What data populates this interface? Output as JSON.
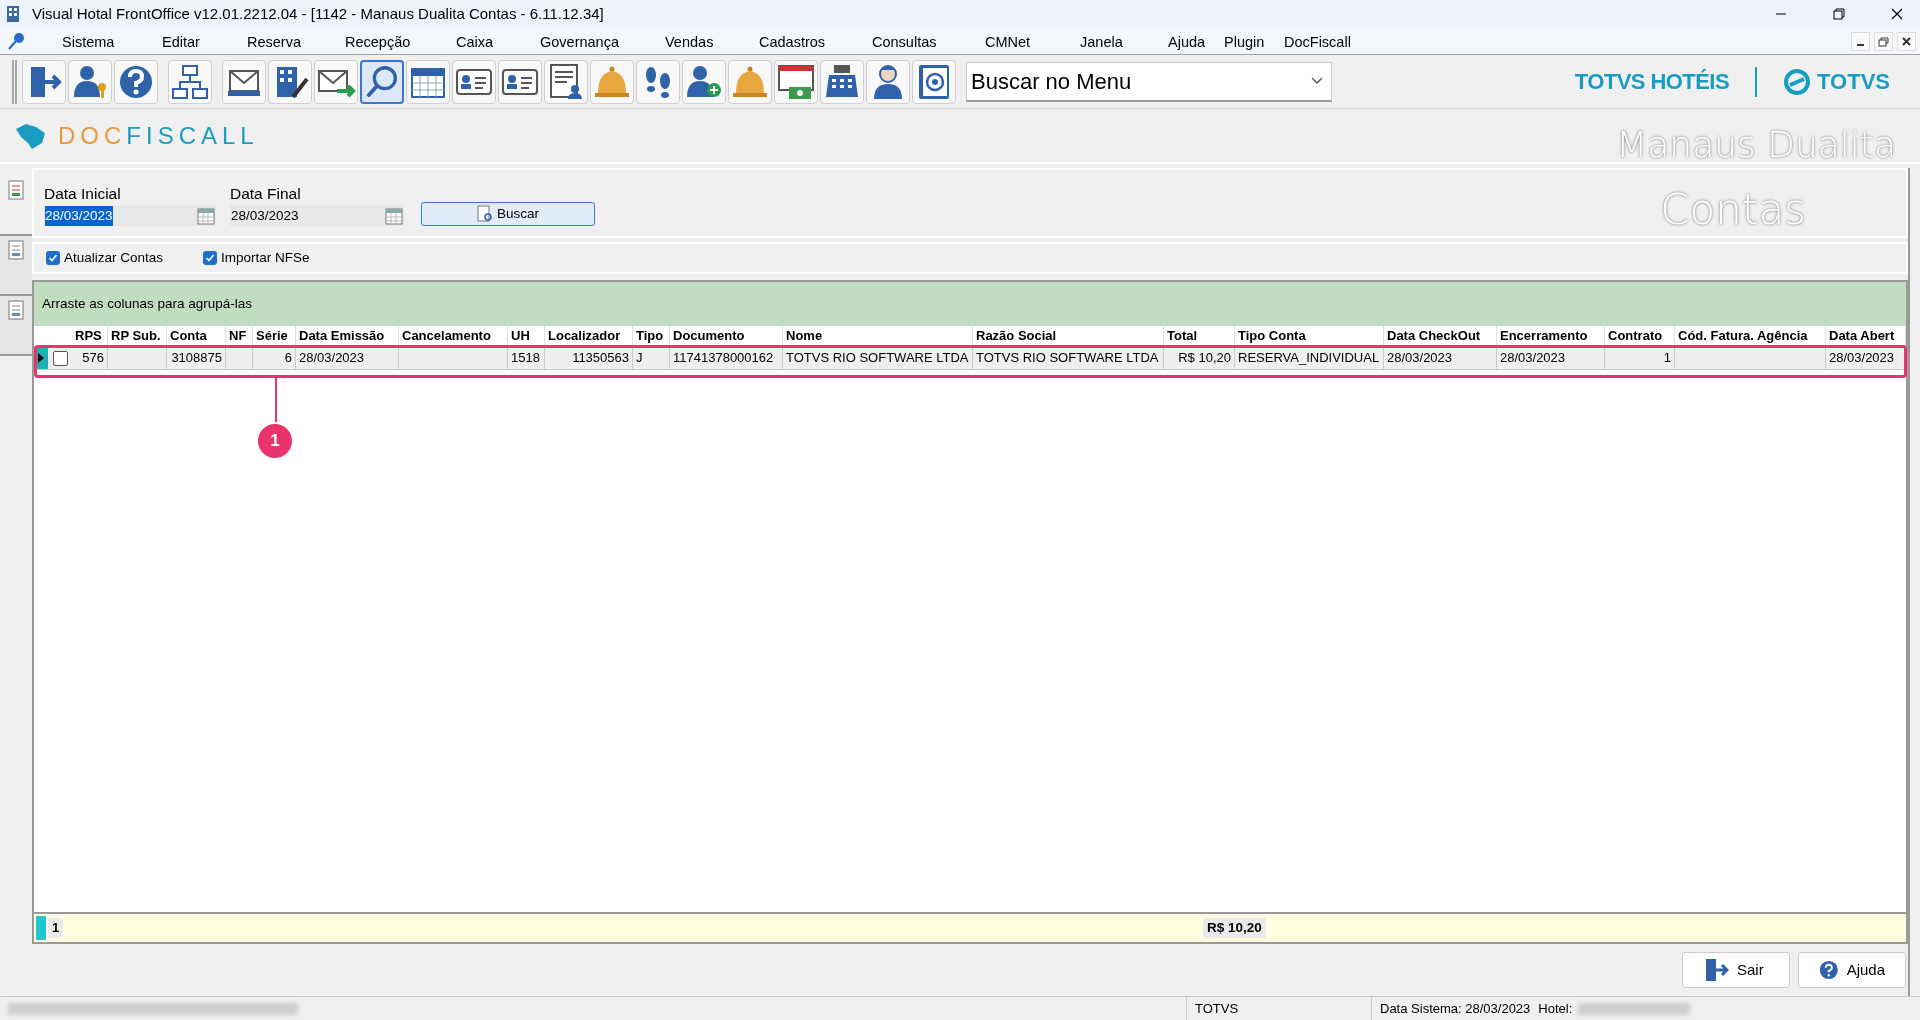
{
  "window": {
    "title": "Visual Hotal FrontOffice v12.01.2212.04 - [1142 - Manaus Dualita Contas - 6.11.12.34]"
  },
  "menu": [
    "Sistema",
    "Editar",
    "Reserva",
    "Recepção",
    "Caixa",
    "Governança",
    "Vendas",
    "Cadastros",
    "Consultas",
    "CMNet",
    "Janela",
    "Ajuda",
    "Plugin",
    "DocFiscall"
  ],
  "toolbar": [
    {
      "kind": "exit",
      "selected": false
    },
    {
      "kind": "userkey",
      "selected": false
    },
    {
      "kind": "help",
      "selected": false
    },
    {
      "kind": "sep"
    },
    {
      "kind": "org",
      "selected": false
    },
    {
      "kind": "sep"
    },
    {
      "kind": "mail",
      "selected": false
    },
    {
      "kind": "building",
      "selected": false
    },
    {
      "kind": "mailarrow",
      "selected": false
    },
    {
      "kind": "search",
      "selected": true
    },
    {
      "kind": "calendar",
      "selected": false
    },
    {
      "kind": "card",
      "selected": false
    },
    {
      "kind": "card",
      "selected": false
    },
    {
      "kind": "docusers",
      "selected": false
    },
    {
      "kind": "bell",
      "selected": false
    },
    {
      "kind": "feet",
      "selected": false
    },
    {
      "kind": "useradd",
      "selected": false
    },
    {
      "kind": "bell",
      "selected": false
    },
    {
      "kind": "money",
      "selected": false
    },
    {
      "kind": "register",
      "selected": false
    },
    {
      "kind": "person",
      "selected": false
    },
    {
      "kind": "at",
      "selected": false
    }
  ],
  "menu_search": {
    "value": "Buscar no Menu"
  },
  "side_tabs": [
    {
      "selected": true
    },
    {
      "selected": false
    },
    {
      "selected": false
    }
  ],
  "brand": {
    "product": "TOTVS HOTÉIS",
    "company": "TOTVS"
  },
  "module": {
    "logo_part1": "DOC",
    "logo_part2": "FISCALL",
    "hotel": "Manaus Dualita",
    "screen": "Contas"
  },
  "filters": {
    "start_label": "Data Inicial",
    "start_value": "28/03/2023",
    "end_label": "Data Final",
    "end_value": "28/03/2023",
    "search_button": "Buscar"
  },
  "options": [
    {
      "label": "Atualizar Contas",
      "checked": true
    },
    {
      "label": "Importar NFSe",
      "checked": true
    }
  ],
  "group_hint": "Arraste as colunas para agrupá-las",
  "table": {
    "columns": [
      "RPS",
      "RP Sub.",
      "Conta",
      "NF",
      "Série",
      "Data Emissão",
      "Cancelamento",
      "UH",
      "Localizador",
      "Tipo",
      "Documento",
      "Nome",
      "Razão Social",
      "Total",
      "Tipo Conta",
      "Data CheckOut",
      "Encerramento",
      "Contrato",
      "Cód. Fatura. Agência",
      "Data Abert"
    ],
    "rows": [
      {
        "selected": true,
        "checked": false,
        "cells": [
          "576",
          "",
          "3108875",
          "",
          "6",
          "28/03/2023",
          "",
          "1518",
          "11350563",
          "J",
          "11741378000162",
          "TOTVS RIO SOFTWARE LTDA",
          "TOTVS RIO SOFTWARE LTDA",
          "R$ 10,20",
          "RESERVA_INDIVIDUAL",
          "28/03/2023",
          "28/03/2023",
          "1",
          "",
          "28/03/2023"
        ]
      }
    ],
    "footer": {
      "count": "1",
      "total": "R$ 10,20"
    }
  },
  "callout": {
    "label": "1"
  },
  "buttons": [
    "Sair",
    "Ajuda"
  ],
  "status_bar": [
    "TOTVS",
    "Data Sistema: 28/03/2023",
    "Hotel:"
  ]
}
